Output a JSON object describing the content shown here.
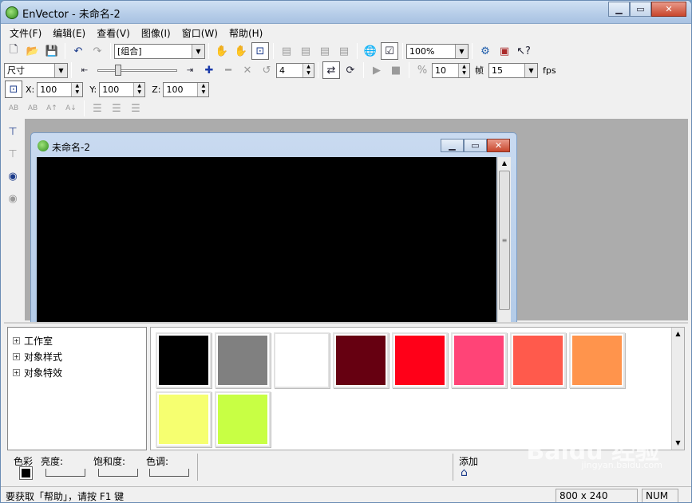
{
  "window": {
    "title": "EnVector - 未命名-2"
  },
  "menu": [
    "文件(F)",
    "编辑(E)",
    "查看(V)",
    "图像(I)",
    "窗口(W)",
    "帮助(H)"
  ],
  "toolbar1": {
    "group_combo": "[组合]",
    "zoom_combo": "100%"
  },
  "toolbar2": {
    "mode_combo": "尺寸",
    "steps_value": "4",
    "frame_value": "10",
    "frame_label": "帧",
    "fps_combo": "15",
    "fps_label": "fps"
  },
  "toolbar3": {
    "x_label": "X:",
    "x_value": "100",
    "y_label": "Y:",
    "y_value": "100",
    "z_label": "Z:",
    "z_value": "100"
  },
  "child_window": {
    "title": "未命名-2"
  },
  "tree": [
    {
      "label": "工作室",
      "expander": "+"
    },
    {
      "label": "对象样式",
      "expander": "+"
    },
    {
      "label": "对象特效",
      "expander": "+"
    }
  ],
  "swatches": [
    "#000000",
    "#808080",
    "#ffffff",
    "#660011",
    "#ff0018",
    "#ff4477",
    "#ff5a4c",
    "#ff944c",
    "#f6ff70",
    "#c8ff44"
  ],
  "color_bar": {
    "color_label": "色彩",
    "brightness_label": "亮度:",
    "saturation_label": "饱和度:",
    "hue_label": "色调:",
    "add_label": "添加"
  },
  "status": {
    "message": "要获取「帮助」，请按 F1 键",
    "size": "800 x 240",
    "num": "NUM"
  },
  "watermark": {
    "main": "Baidu 经验",
    "sub": "jingyan.baidu.com"
  }
}
